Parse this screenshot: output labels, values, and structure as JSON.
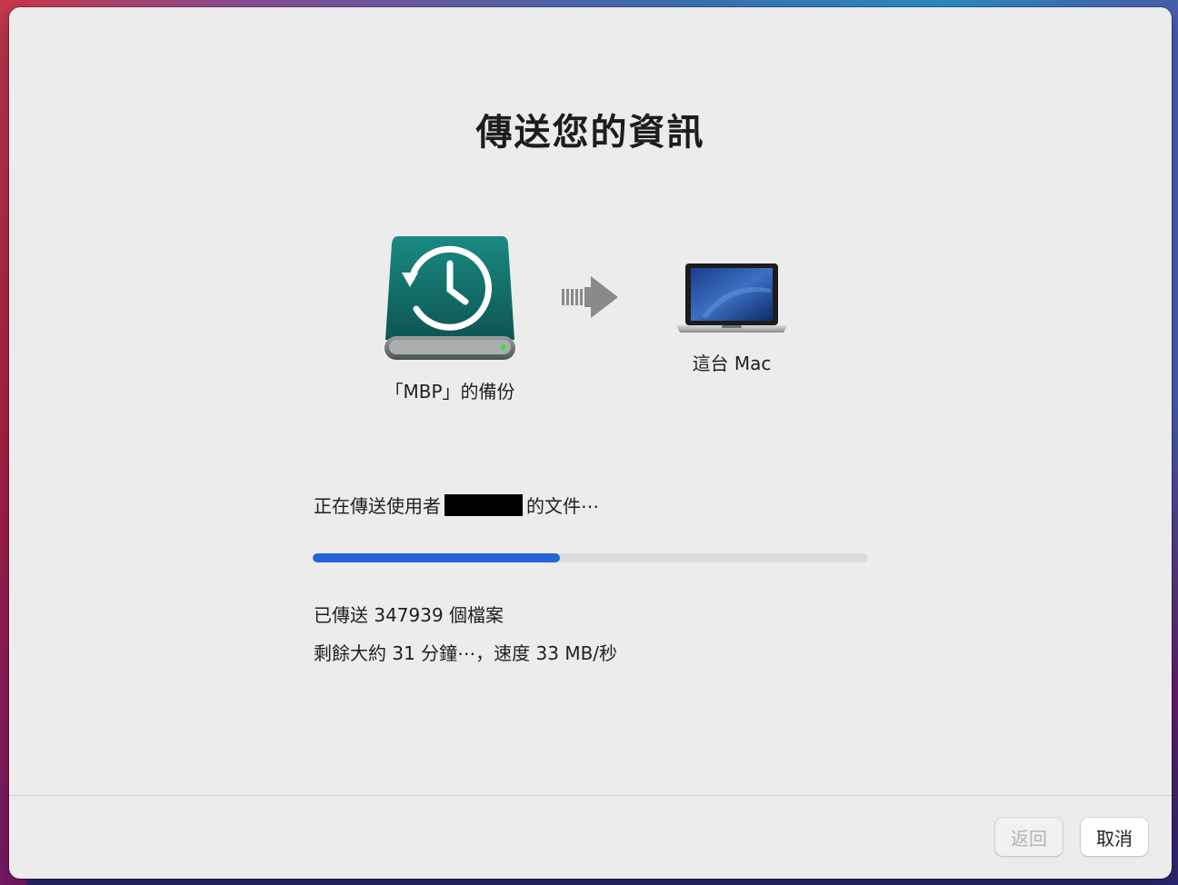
{
  "window": {
    "title": "傳送您的資訊"
  },
  "transfer": {
    "source_label": "「MBP」的備份",
    "destination_label": "這台 Mac",
    "status_prefix": "正在傳送使用者",
    "status_suffix": "的文件⋯",
    "progress_fraction": 0.445,
    "files_sent": "已傳送 347939 個檔案",
    "time_remaining": "剩餘大約 31 分鐘⋯，速度 33 MB/秒"
  },
  "buttons": {
    "back_label": "返回",
    "cancel_label": "取消"
  },
  "colors": {
    "accent": "#2563d8",
    "drive": "#16706c"
  },
  "icons": {
    "source": "time-machine-drive-icon",
    "arrow": "transfer-arrow-icon",
    "destination": "macbook-laptop-icon"
  }
}
